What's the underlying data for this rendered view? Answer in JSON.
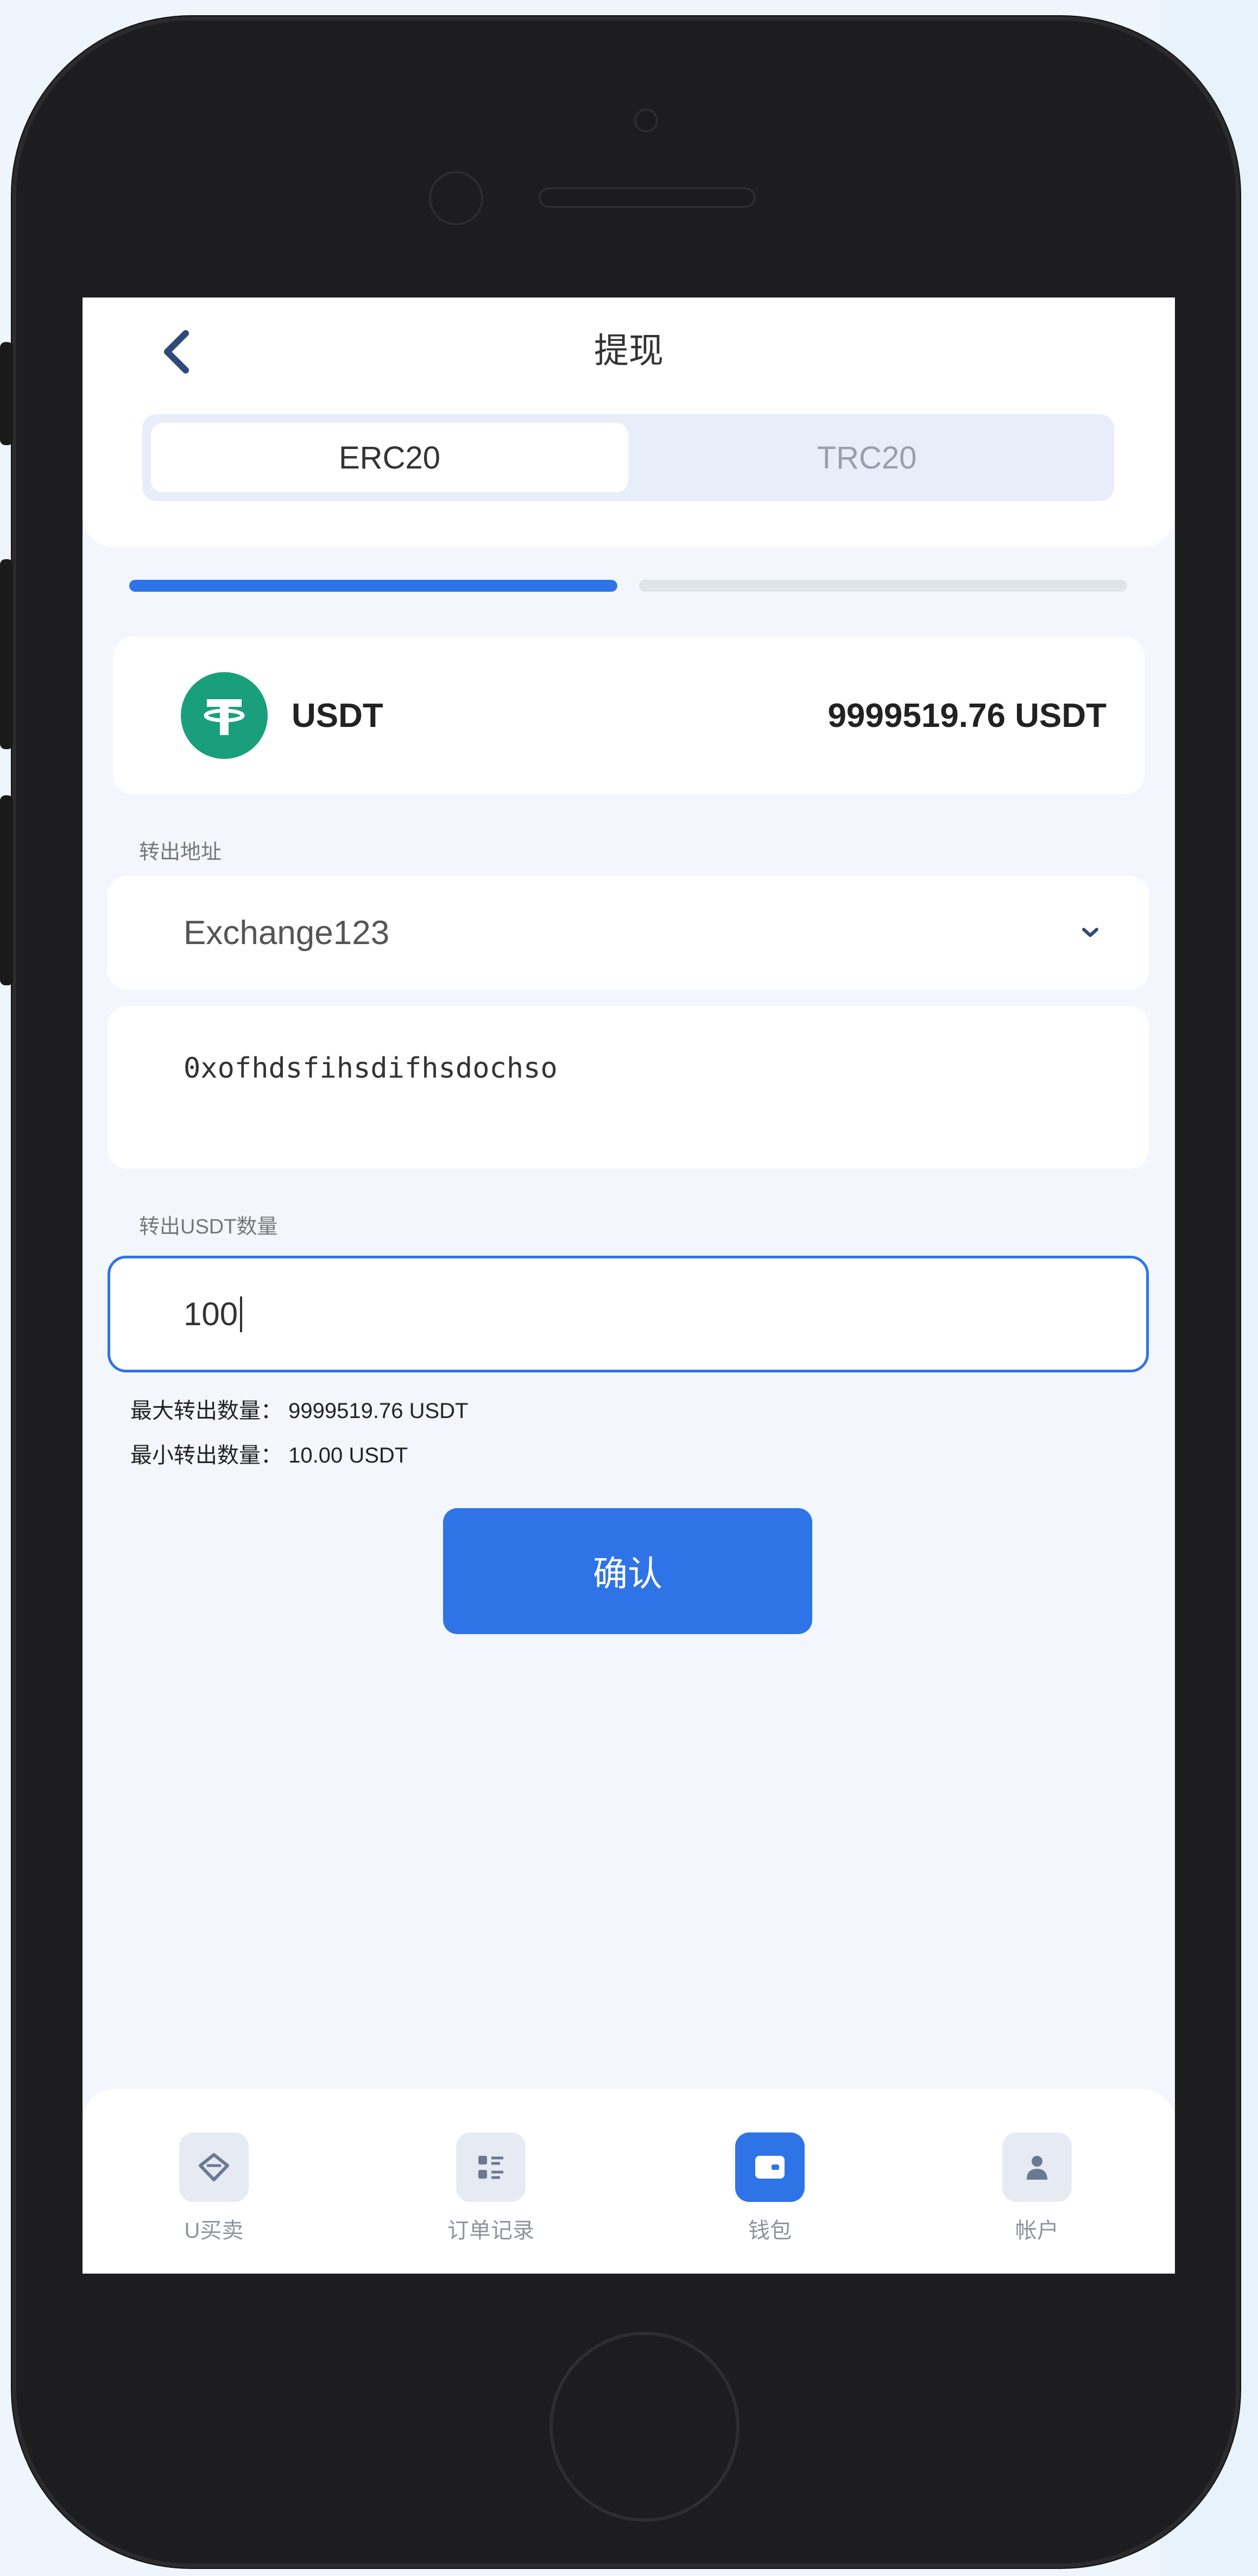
{
  "header": {
    "title": "提现",
    "back_icon": "chevron-left-icon"
  },
  "tabs": [
    {
      "label": "ERC20",
      "active": true
    },
    {
      "label": "TRC20",
      "active": false
    }
  ],
  "progress": {
    "step": 1,
    "total_steps": 2
  },
  "coin": {
    "name": "USDT",
    "balance": "9999519.76 USDT",
    "icon": "tether-icon"
  },
  "form": {
    "address_label": "转出地址",
    "address_select_value": "Exchange123",
    "address_value": "0xofhdsfihsdifhsdochso",
    "amount_label": "转出USDT数量",
    "amount_value": "100",
    "max_label": "最大转出数量：",
    "max_value": "9999519.76 USDT",
    "min_label": "最小转出数量：",
    "min_value": "10.00 USDT"
  },
  "confirm_label": "确认",
  "bottom_nav": [
    {
      "label": "U买卖",
      "icon": "diamond-icon",
      "active": false
    },
    {
      "label": "订单记录",
      "icon": "list-icon",
      "active": false
    },
    {
      "label": "钱包",
      "icon": "wallet-icon",
      "active": true
    },
    {
      "label": "帐户",
      "icon": "user-icon",
      "active": false
    }
  ],
  "colors": {
    "accent": "#2f74e6",
    "tether": "#1a9f7c"
  }
}
